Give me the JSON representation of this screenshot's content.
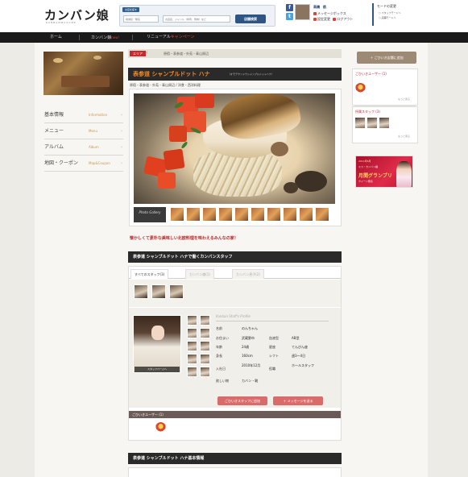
{
  "header": {
    "logo": "カンバン娘",
    "logo_sub": "KANBANMUSUME",
    "search": {
      "label": "お店を探す",
      "area_placeholder": "地域名・駅名",
      "keyword_placeholder": "お店名、ジャンル（寿司、焼肉）など",
      "button": "店舗検索"
    },
    "user": {
      "name": "高橋　航",
      "message_box": "メッセージボックス",
      "settings": "設定変更",
      "logout": "ログアウト"
    },
    "mode": {
      "title": "モードの変更",
      "staff_mode": "スタッフモードへ",
      "store_mode": "店舗モードへ"
    }
  },
  "nav": {
    "items": [
      {
        "label": "ホーム"
      },
      {
        "label": "カンバン娘",
        "badge": "new!"
      },
      {
        "label": "リニューアル",
        "accent": "キャンペーン"
      }
    ]
  },
  "sidebar": {
    "items": [
      {
        "label": "基本情報",
        "en": "Information"
      },
      {
        "label": "メニュー",
        "en": "Menu"
      },
      {
        "label": "アルバム",
        "en": "Album"
      },
      {
        "label": "地図・クーポン",
        "en": "Map&Coupon"
      }
    ]
  },
  "breadcrumb": {
    "tag": "エリア",
    "path": "原宿・表参道・外苑・青山周辺"
  },
  "shop": {
    "name": "表参道 シャンブルドット ハナ",
    "kana": "（オモテサンドウシャンブルドットハナ）",
    "area": "原宿・表参道・外苑・青山周辺 / 洋食・西洋料理",
    "photo_gallery": "Photo Gallery",
    "tagline": "懐かしくて素朴な美味しい北欧料理を味わえるみんなの家！"
  },
  "staff": {
    "header": "表参道 シャンブルドット ハナで働くカンバンスタッフ",
    "tabs": [
      "すべてのスタッフ(3)",
      "カンバン娘(1)",
      "カンバン息子(2)"
    ],
    "photo_caption": "スタッフページへ",
    "profile_title": "Kanban Staff's Profile",
    "profile": {
      "name_label": "名前",
      "name": "のんちゃん",
      "home_label": "お住まい",
      "home": "武蔵野市",
      "blood_label": "血液型",
      "blood": "AB型",
      "age_label": "年齢",
      "age": "24歳",
      "star_label": "星座",
      "star": "てんびん座",
      "height_label": "身長",
      "height": "160cm",
      "shift_label": "シフト",
      "shift": "週3〜4日",
      "joined_label": "入社日",
      "joined": "2010年12月",
      "role_label": "役職",
      "role": "ホールスタッフ",
      "wish_label": "欲しい物",
      "wish": "カバン・靴"
    },
    "btn_favorite": "ごひいきスタッフに追加",
    "btn_message": "メッセージを送る",
    "fav_users_label": "ごひいきユーザー (1)"
  },
  "basic_info": {
    "header": "表参道 シャンブルドット ハナ基本情報"
  },
  "right": {
    "add_store": "ごひいき店舗に追加",
    "fav_users_title": "ごひいきユーザー (1)",
    "more1": "もっと見る",
    "fav_staff_title": "所属スタッフ (3)",
    "more2": "もっと見る",
    "banner": {
      "line1": "2011年6月",
      "line2": "ミス・カンバン娘",
      "line3": "月間グランプリ",
      "line4": "クイーン発表"
    }
  },
  "colors": {
    "accent_red": "#c8282e",
    "nav_bg": "#1a1a1a",
    "shop_name": "#f08a2a",
    "search_button": "#2f5585"
  }
}
